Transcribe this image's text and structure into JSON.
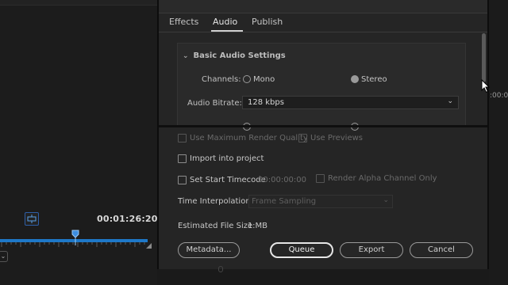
{
  "program_monitor": {
    "timecode": "00:01:26:20",
    "playhead_fraction": 0.51
  },
  "export_dialog": {
    "tabs": [
      {
        "label": "Effects",
        "active": false
      },
      {
        "label": "Audio",
        "active": true
      },
      {
        "label": "Publish",
        "active": false
      }
    ],
    "audio": {
      "section_title": "Basic Audio Settings",
      "channels_label": "Channels:",
      "channel_options": [
        {
          "label": "Mono",
          "selected": false
        },
        {
          "label": "Stereo",
          "selected": true
        }
      ],
      "bitrate_label": "Audio Bitrate:",
      "bitrate_value": "128 kbps"
    },
    "options": {
      "max_render_quality": {
        "label": "Use Maximum Render Quality",
        "checked": false,
        "enabled": false
      },
      "use_previews": {
        "label": "Use Previews",
        "checked": false,
        "enabled": false
      },
      "import_into_project": {
        "label": "Import into project",
        "checked": false,
        "enabled": true
      },
      "set_start_timecode": {
        "label": "Set Start Timecode",
        "checked": false,
        "enabled": true,
        "value": "00:00:00:00"
      },
      "render_alpha": {
        "label": "Render Alpha Channel Only",
        "checked": false,
        "enabled": false
      }
    },
    "time_interpolation": {
      "label": "Time Interpolation:",
      "value": "Frame Sampling",
      "enabled": false
    },
    "file_size": {
      "label": "Estimated File Size:",
      "value": "1 MB"
    },
    "buttons": {
      "metadata": "Metadata...",
      "queue": "Queue",
      "export": "Export",
      "cancel": "Cancel"
    }
  },
  "right_panel": {
    "ruler_text": ":00:00"
  },
  "colors": {
    "accent_blue": "#1e78c8",
    "dialog_bg": "#252525",
    "panel_bg": "#1c1c1c"
  }
}
